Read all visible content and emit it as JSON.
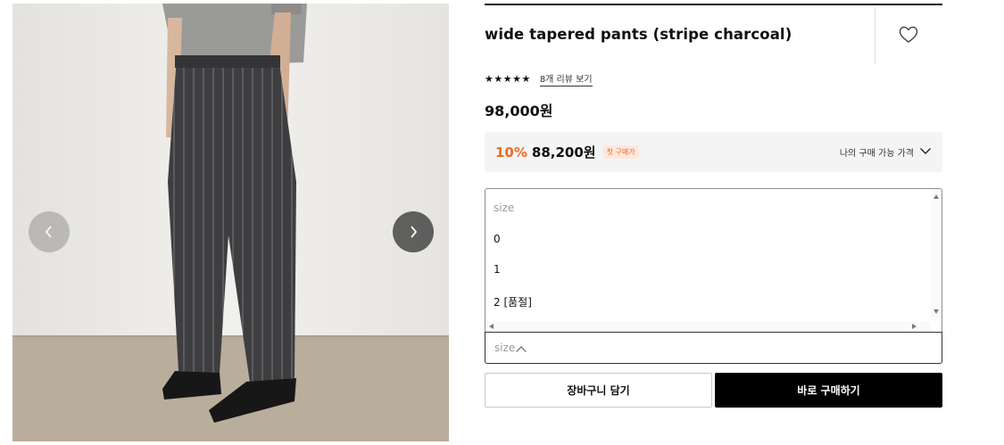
{
  "product": {
    "title": "wide tapered pants (stripe charcoal)",
    "rating_stars": "★★★★★",
    "reviews_link": "8개 리뷰 보기",
    "price": "98,000원"
  },
  "promo": {
    "discount_rate": "10%",
    "discounted_price": "88,200원",
    "badge": "첫 구매가",
    "link_label": "나의 구매 가능 가격"
  },
  "size_select": {
    "placeholder": "size",
    "options": [
      "size",
      "0",
      "1",
      "2 [품절]"
    ]
  },
  "actions": {
    "cart_label": "장바구니 담기",
    "buy_label": "바로 구매하기"
  },
  "colors": {
    "accent_orange": "#ee6a23",
    "buy_button": "#000000"
  },
  "icons": {
    "prev": "chevron-left-icon",
    "next": "chevron-right-icon",
    "wish": "heart-outline-icon",
    "promo_toggle": "chevron-down-icon",
    "select_toggle": "chevron-up-icon"
  }
}
